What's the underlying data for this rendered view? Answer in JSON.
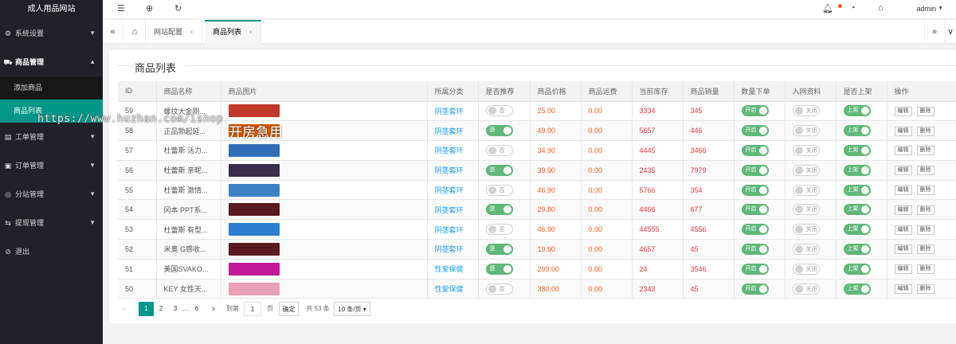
{
  "app": {
    "brand": "成人用品网站"
  },
  "sidebar": {
    "items": [
      {
        "label": "系统设置",
        "icon": "gear-icon",
        "glyph": "⚙"
      },
      {
        "label": "商品管理",
        "icon": "cart-icon",
        "glyph": "🛒"
      },
      {
        "label": "工单管理",
        "icon": "ticket-icon",
        "glyph": "▤"
      },
      {
        "label": "订单管理",
        "icon": "order-icon",
        "glyph": "▣"
      },
      {
        "label": "分站管理",
        "icon": "branch-icon",
        "glyph": "◎"
      },
      {
        "label": "提现管理",
        "icon": "withdraw-icon",
        "glyph": "⇆"
      },
      {
        "label": "退出",
        "icon": "logout-icon",
        "glyph": "⊘"
      }
    ],
    "sub": [
      {
        "label": "添加商品"
      },
      {
        "label": "商品列表"
      }
    ]
  },
  "header": {
    "user": "admin"
  },
  "tabs": [
    {
      "label": "网站配置",
      "close": "×"
    },
    {
      "label": "商品列表",
      "close": "×"
    }
  ],
  "panel": {
    "title": "商品列表"
  },
  "table": {
    "headers": [
      "ID",
      "商品名称",
      "商品图片",
      "所属分类",
      "是否推荐",
      "商品价格",
      "商品运费",
      "当前库存",
      "商品销量",
      "数量下单",
      "入网资料",
      "是否上架",
      "操作"
    ],
    "rows": [
      {
        "id": "59",
        "name": "螺纹大金刚...",
        "category": "阴茎套环",
        "recommend": "否",
        "price": "25.00",
        "freight": "0.00",
        "stock": "3334",
        "sales": "345",
        "qty": "开启",
        "net": "关闭",
        "shelf": "上架",
        "img_color": "#c0392b"
      },
      {
        "id": "58",
        "name": "正品勃起延...",
        "category": "阴茎套环",
        "recommend": "是",
        "price": "49.00",
        "freight": "0.00",
        "stock": "5657",
        "sales": "446",
        "qty": "开启",
        "net": "关闭",
        "shelf": "上架",
        "img_color": "#d35400"
      },
      {
        "id": "57",
        "name": "杜蕾斯 活力...",
        "category": "阴茎套环",
        "recommend": "否",
        "price": "34.90",
        "freight": "0.00",
        "stock": "4445",
        "sales": "3466",
        "qty": "开启",
        "net": "关闭",
        "shelf": "上架",
        "img_color": "#2f6fb7"
      },
      {
        "id": "56",
        "name": "杜蕾斯 亲昵...",
        "category": "阴茎套环",
        "recommend": "是",
        "price": "39.90",
        "freight": "0.00",
        "stock": "2435",
        "sales": "7979",
        "qty": "开启",
        "net": "关闭",
        "shelf": "上架",
        "img_color": "#3a2d4a"
      },
      {
        "id": "55",
        "name": "杜蕾斯 激情...",
        "category": "阴茎套环",
        "recommend": "否",
        "price": "46.90",
        "freight": "0.00",
        "stock": "5766",
        "sales": "354",
        "qty": "开启",
        "net": "关闭",
        "shelf": "上架",
        "img_color": "#3b82c4"
      },
      {
        "id": "54",
        "name": "冈本 PPT系...",
        "category": "阴茎套环",
        "recommend": "是",
        "price": "29.80",
        "freight": "0.00",
        "stock": "4466",
        "sales": "677",
        "qty": "开启",
        "net": "关闭",
        "shelf": "上架",
        "img_color": "#5a1a22"
      },
      {
        "id": "53",
        "name": "杜蕾斯 有型...",
        "category": "阴茎套环",
        "recommend": "否",
        "price": "46.90",
        "freight": "0.00",
        "stock": "44555",
        "sales": "4556",
        "qty": "开启",
        "net": "关闭",
        "shelf": "上架",
        "img_color": "#2d7dd2"
      },
      {
        "id": "52",
        "name": "米奥 G感收...",
        "category": "阴茎套环",
        "recommend": "是",
        "price": "19.90",
        "freight": "0.00",
        "stock": "4657",
        "sales": "45",
        "qty": "开启",
        "net": "关闭",
        "shelf": "上架",
        "img_color": "#5a1a22"
      },
      {
        "id": "51",
        "name": "美国SVAKO...",
        "category": "性爱保健",
        "recommend": "是",
        "price": "299.00",
        "freight": "0.00",
        "stock": "24",
        "sales": "3546",
        "qty": "开启",
        "net": "关闭",
        "shelf": "上架",
        "img_color": "#c2189b"
      },
      {
        "id": "50",
        "name": "KEY 女性天...",
        "category": "性爱保健",
        "recommend": "否",
        "price": "380.00",
        "freight": "0.00",
        "stock": "2343",
        "sales": "45",
        "qty": "开启",
        "net": "关闭",
        "shelf": "上架",
        "img_color": "#e8a0b4"
      }
    ],
    "op_edit": "编辑",
    "op_delete": "删除"
  },
  "pager": {
    "prev": "‹",
    "pages": [
      "1",
      "2",
      "3"
    ],
    "ellipsis": "…",
    "last": "6",
    "next": "›",
    "goto_label": "到第",
    "goto_value": "1",
    "page_unit": "页",
    "confirm": "确定",
    "total": "共 53 条",
    "size": "10 条/页"
  },
  "watermark": {
    "url": "https://www.huzhan.com/ishop",
    "overlay": "开房急用"
  },
  "colors": {
    "accent": "#009688",
    "sidebar": "#20222a",
    "switch_on": "#5fb878",
    "price": "#ff5722",
    "category": "#1e9fff"
  }
}
